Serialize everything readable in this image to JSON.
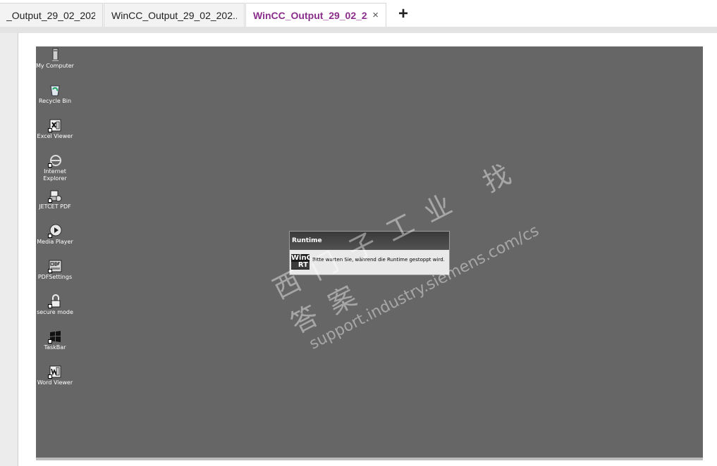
{
  "tabs": [
    {
      "label": "_Output_29_02_202...",
      "active": false
    },
    {
      "label": "WinCC_Output_29_02_202...",
      "active": false
    },
    {
      "label": "WinCC_Output_29_02_2...",
      "active": true
    }
  ],
  "tab_close_glyph": "×",
  "new_tab_glyph": "+",
  "desktop_icons": [
    {
      "label": "My Computer",
      "icon": "computer-icon"
    },
    {
      "label": "Recycle Bin",
      "icon": "recycle-bin-icon"
    },
    {
      "label": "Excel Viewer",
      "icon": "excel-icon"
    },
    {
      "label": "Internet Explorer",
      "icon": "globe-icon"
    },
    {
      "label": "JETCET PDF",
      "icon": "printer-icon"
    },
    {
      "label": "Media Player",
      "icon": "play-icon"
    },
    {
      "label": "PDFSettings",
      "icon": "pdf-icon"
    },
    {
      "label": "secure mode",
      "icon": "lock-icon"
    },
    {
      "label": "TaskBar",
      "icon": "windows-icon"
    },
    {
      "label": "Word Viewer",
      "icon": "word-icon"
    }
  ],
  "dialog": {
    "title": "Runtime",
    "logo_line1": "WinCC",
    "logo_line2": "RT",
    "message": "Bitte warten Sie, während die Runtime gestoppt wird."
  },
  "watermark": {
    "line1": "西门子工业 找答案",
    "line2": "support.industry.siemens.com/cs"
  },
  "colors": {
    "active_tab_text": "#8b2e8b",
    "desktop_background": "#666666"
  }
}
